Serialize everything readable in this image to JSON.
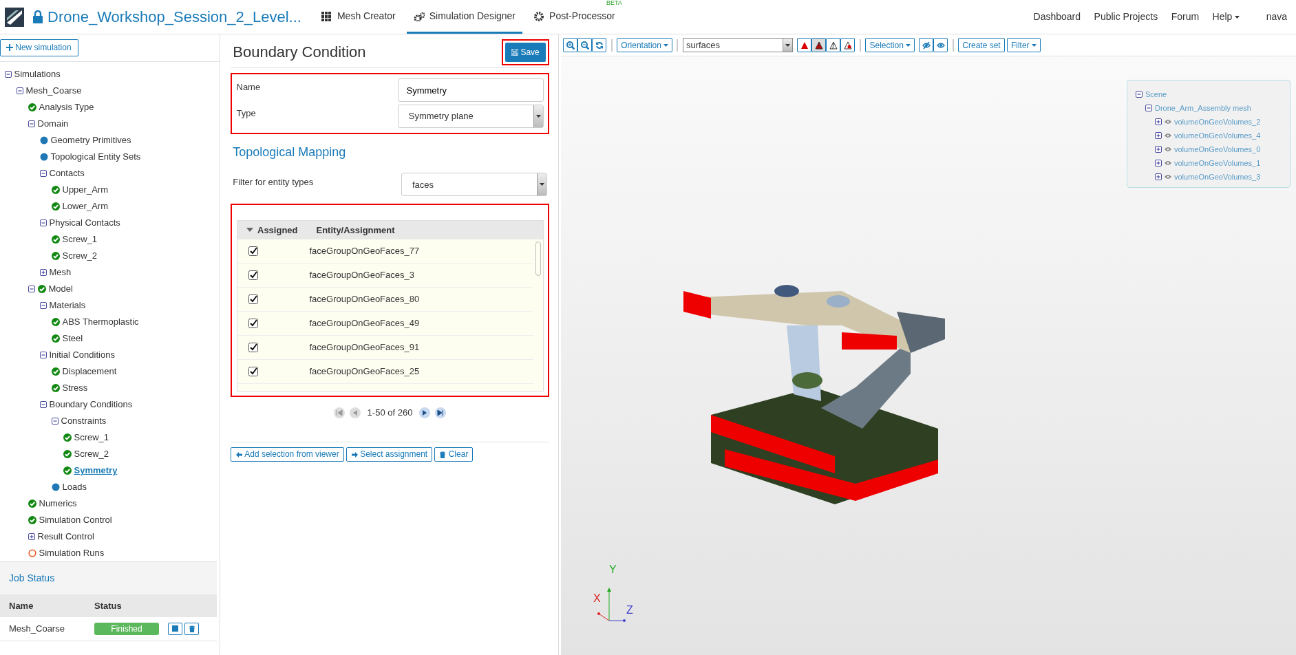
{
  "app": {
    "title": "Drone_Workshop_Session_2_Level...",
    "nav": [
      {
        "label": "Mesh Creator",
        "selected": false
      },
      {
        "label": "Simulation Designer",
        "selected": true
      },
      {
        "label": "Post-Processor",
        "selected": false,
        "badge": "BETA"
      }
    ],
    "right_nav": [
      {
        "label": "Dashboard",
        "dropdown": false
      },
      {
        "label": "Public Projects",
        "dropdown": false
      },
      {
        "label": "Forum",
        "dropdown": false
      },
      {
        "label": "Help",
        "dropdown": true
      }
    ],
    "user": "nava"
  },
  "sidebar": {
    "new_button": "New simulation",
    "tree": [
      {
        "label": "Simulations",
        "expanded": true,
        "selected": false,
        "children": [
          {
            "label": "Mesh_Coarse",
            "expanded": true,
            "selected": false,
            "children": [
              {
                "label": "Analysis Type",
                "kind": "check",
                "selected": false
              },
              {
                "label": "Domain",
                "expanded": true,
                "selected": false,
                "children": [
                  {
                    "label": "Geometry Primitives",
                    "kind": "dot",
                    "selected": false
                  },
                  {
                    "label": "Topological Entity Sets",
                    "kind": "dot",
                    "selected": false
                  },
                  {
                    "label": "Contacts",
                    "expanded": true,
                    "selected": false,
                    "children": [
                      {
                        "label": "Upper_Arm",
                        "kind": "check",
                        "selected": false
                      },
                      {
                        "label": "Lower_Arm",
                        "kind": "check",
                        "selected": false
                      }
                    ]
                  },
                  {
                    "label": "Physical Contacts",
                    "expanded": true,
                    "selected": false,
                    "children": [
                      {
                        "label": "Screw_1",
                        "kind": "check",
                        "selected": false
                      },
                      {
                        "label": "Screw_2",
                        "kind": "check",
                        "selected": false
                      }
                    ]
                  },
                  {
                    "label": "Mesh",
                    "expanded": false,
                    "selected": false
                  }
                ]
              },
              {
                "label": "Model",
                "kind": "check",
                "expanded": true,
                "selected": false,
                "children": [
                  {
                    "label": "Materials",
                    "expanded": true,
                    "selected": false,
                    "children": [
                      {
                        "label": "ABS Thermoplastic",
                        "kind": "check",
                        "selected": false
                      },
                      {
                        "label": "Steel",
                        "kind": "check",
                        "selected": false
                      }
                    ]
                  },
                  {
                    "label": "Initial Conditions",
                    "expanded": true,
                    "selected": false,
                    "children": [
                      {
                        "label": "Displacement",
                        "kind": "check",
                        "selected": false
                      },
                      {
                        "label": "Stress",
                        "kind": "check",
                        "selected": false
                      }
                    ]
                  },
                  {
                    "label": "Boundary Conditions",
                    "expanded": true,
                    "selected": false,
                    "children": [
                      {
                        "label": "Constraints",
                        "expanded": true,
                        "selected": false,
                        "children": [
                          {
                            "label": "Screw_1",
                            "kind": "check",
                            "selected": false
                          },
                          {
                            "label": "Screw_2",
                            "kind": "check",
                            "selected": false
                          },
                          {
                            "label": "Symmetry",
                            "kind": "check",
                            "selected": true
                          }
                        ]
                      },
                      {
                        "label": "Loads",
                        "kind": "dot",
                        "selected": false
                      }
                    ]
                  }
                ]
              },
              {
                "label": "Numerics",
                "kind": "check",
                "selected": false
              },
              {
                "label": "Simulation Control",
                "kind": "check",
                "selected": false
              },
              {
                "label": "Result Control",
                "expanded": false,
                "selected": false
              },
              {
                "label": "Simulation Runs",
                "kind": "ring",
                "selected": false
              }
            ]
          }
        ]
      }
    ]
  },
  "job_status": {
    "title": "Job Status",
    "columns": [
      "Name",
      "Status"
    ],
    "rows": [
      {
        "name": "Mesh_Coarse",
        "status": "Finished"
      }
    ]
  },
  "panel": {
    "title": "Boundary Condition",
    "save": "Save",
    "fields": [
      {
        "label": "Name",
        "kind": "text",
        "value": "Symmetry"
      },
      {
        "label": "Type",
        "kind": "select",
        "value": "Symmetry plane"
      }
    ],
    "section": "Topological Mapping",
    "filter": {
      "label": "Filter for entity types",
      "value": "faces"
    },
    "table": {
      "columns": [
        "Assigned",
        "Entity/Assignment"
      ],
      "rows": [
        {
          "checked": true,
          "entity": "faceGroupOnGeoFaces_77"
        },
        {
          "checked": true,
          "entity": "faceGroupOnGeoFaces_3"
        },
        {
          "checked": true,
          "entity": "faceGroupOnGeoFaces_80"
        },
        {
          "checked": true,
          "entity": "faceGroupOnGeoFaces_49"
        },
        {
          "checked": true,
          "entity": "faceGroupOnGeoFaces_91"
        },
        {
          "checked": true,
          "entity": "faceGroupOnGeoFaces_25"
        }
      ]
    },
    "pager": "1-50 of 260",
    "actions": [
      {
        "label": "Add selection from viewer"
      },
      {
        "label": "Select assignment"
      },
      {
        "label": "Clear"
      }
    ]
  },
  "viewer": {
    "orientation": "Orientation",
    "render_mode": "surfaces",
    "modes": [
      {
        "selected": false
      },
      {
        "selected": true
      },
      {
        "selected": false
      },
      {
        "selected": false
      }
    ],
    "selection": "Selection",
    "create_set": "Create set",
    "filter": "Filter",
    "scene": [
      {
        "label": "Scene",
        "expanded": true,
        "children": [
          {
            "label": "Drone_Arm_Assembly mesh",
            "expanded": true,
            "children": [
              {
                "label": "volumeOnGeoVolumes_2",
                "expanded": false,
                "visible": true
              },
              {
                "label": "volumeOnGeoVolumes_4",
                "expanded": false,
                "visible": true
              },
              {
                "label": "volumeOnGeoVolumes_0",
                "expanded": false,
                "visible": true
              },
              {
                "label": "volumeOnGeoVolumes_1",
                "expanded": false,
                "visible": true
              },
              {
                "label": "volumeOnGeoVolumes_3",
                "expanded": false,
                "visible": true
              }
            ]
          }
        ]
      }
    ],
    "axes": [
      "X",
      "Y",
      "Z"
    ]
  }
}
